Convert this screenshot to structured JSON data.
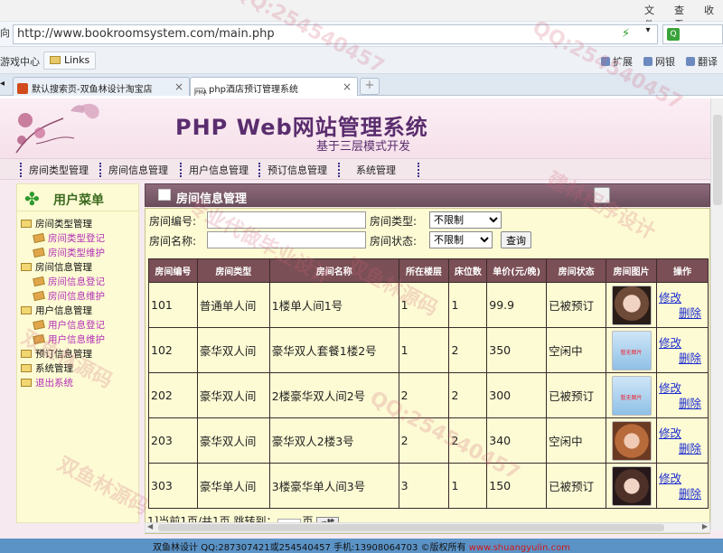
{
  "browser": {
    "menu": [
      "文件",
      "查看",
      "收"
    ],
    "address": "http://www.bookroomsystem.com/main.php",
    "address_prefix": "向",
    "favorites": {
      "games": "游戏中心",
      "links": "Links"
    },
    "tools": [
      "扩展",
      "网银",
      "翻译"
    ],
    "tabs": [
      {
        "label": "默认搜索页-双鱼林设计淘宝店"
      },
      {
        "label": "php酒店预订管理系统"
      }
    ],
    "tab_pma": "PMA"
  },
  "banner": {
    "title": "PHP Web网站管理系统",
    "subtitle": "基于三层模式开发"
  },
  "nav": {
    "items": [
      "房间类型管理",
      "房间信息管理",
      "用户信息管理",
      "预订信息管理",
      "系统管理"
    ]
  },
  "sidebar": {
    "title": "用户菜单",
    "items": [
      {
        "label": "房间类型管理",
        "kind": "root"
      },
      {
        "label": "房间类型登记",
        "kind": "leaf"
      },
      {
        "label": "房间类型维护",
        "kind": "leaf"
      },
      {
        "label": "房间信息管理",
        "kind": "root"
      },
      {
        "label": "房间信息登记",
        "kind": "leaf"
      },
      {
        "label": "房间信息维护",
        "kind": "leaf"
      },
      {
        "label": "用户信息管理",
        "kind": "root"
      },
      {
        "label": "用户信息登记",
        "kind": "leaf"
      },
      {
        "label": "用户信息维护",
        "kind": "leaf"
      },
      {
        "label": "预订信息管理",
        "kind": "root"
      },
      {
        "label": "系统管理",
        "kind": "root"
      },
      {
        "label": "退出系统",
        "kind": "exit"
      }
    ]
  },
  "main": {
    "title": "房间信息管理",
    "filters": {
      "room_no_label": "房间编号:",
      "room_type_label": "房间类型:",
      "room_type_value": "不限制",
      "room_name_label": "房间名称:",
      "room_status_label": "房间状态:",
      "room_status_value": "不限制",
      "search_button": "查询"
    },
    "columns": [
      "房间编号",
      "房间类型",
      "房间名称",
      "所在楼层",
      "床位数",
      "单价(元/晚)",
      "房间状态",
      "房间图片",
      "操作"
    ],
    "rows": [
      {
        "no": "101",
        "type": "普通单人间",
        "name": "1楼单人间1号",
        "floor": "1",
        "beds": "1",
        "price": "99.9",
        "status": "已被预订",
        "image": "face"
      },
      {
        "no": "102",
        "type": "豪华双人间",
        "name": "豪华双人套餐1楼2号",
        "floor": "1",
        "beds": "2",
        "price": "350",
        "status": "空闲中",
        "image": "noimg"
      },
      {
        "no": "202",
        "type": "豪华双人间",
        "name": "2楼豪华双人间2号",
        "floor": "2",
        "beds": "2",
        "price": "300",
        "status": "已被预订",
        "image": "noimg"
      },
      {
        "no": "203",
        "type": "豪华双人间",
        "name": "豪华双人2楼3号",
        "floor": "2",
        "beds": "2",
        "price": "340",
        "status": "空闲中",
        "image": "face2"
      },
      {
        "no": "303",
        "type": "豪华单人间",
        "name": "3楼豪华单人间3号",
        "floor": "3",
        "beds": "1",
        "price": "150",
        "status": "已被预订",
        "image": "face3"
      }
    ],
    "noimage_text": "暂无图片",
    "edit_label": "修改",
    "delete_label": "删除",
    "pager": {
      "text": "1]当前1页/共1页 跳转到：",
      "page_unit": "页",
      "go": "➡转"
    }
  },
  "footer": {
    "text": "双鱼林设计 QQ:287307421或254540457 手机:13908064703 ©版权所有",
    "site": "www.shuangyulin.com"
  },
  "watermarks": [
    "QQ:254540457",
    "双鱼林源码",
    "专业代做毕业设计",
    "双鱼林源码",
    "QQ:254540457",
    "建林程序设计",
    "QQ:254540457",
    "双鱼林源码"
  ]
}
